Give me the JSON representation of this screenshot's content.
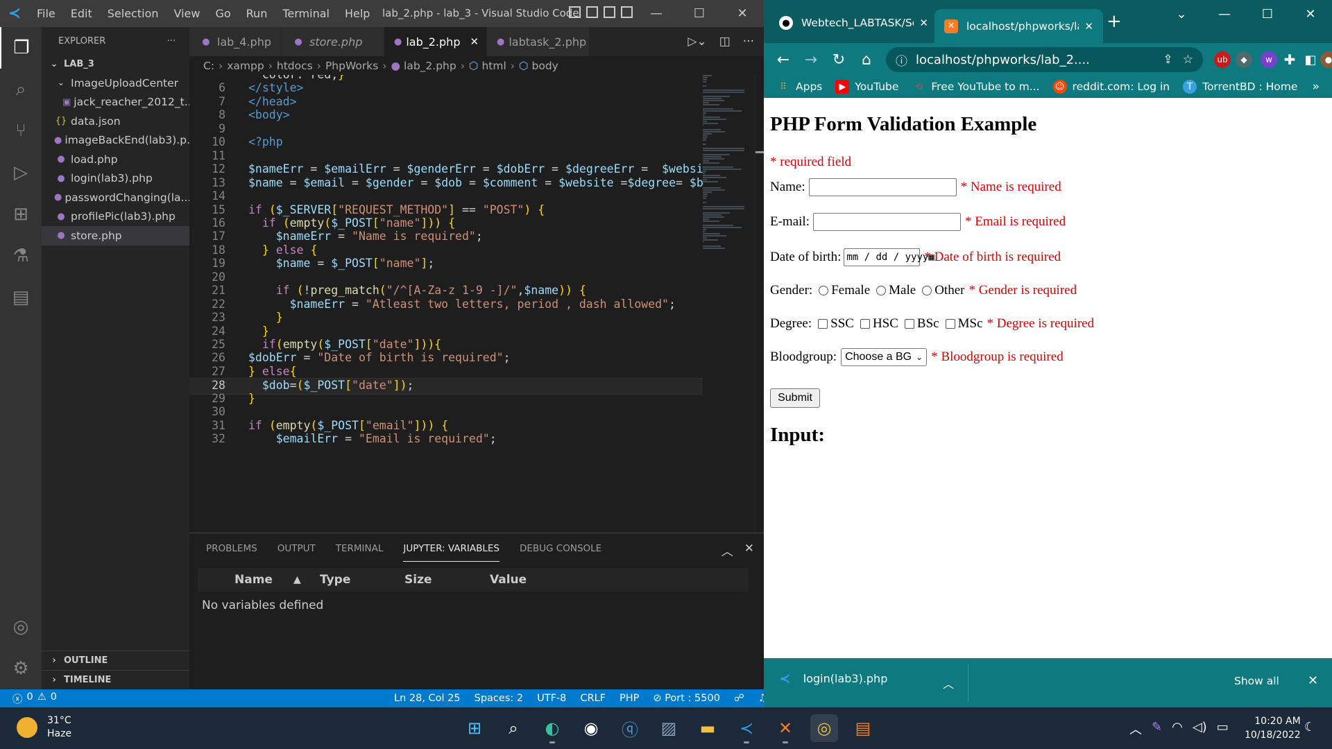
{
  "vscode": {
    "menu": [
      "File",
      "Edit",
      "Selection",
      "View",
      "Go",
      "Run",
      "Terminal",
      "Help"
    ],
    "title": "lab_2.php - lab_3 - Visual Studio Code",
    "explorer": {
      "header": "EXPLORER",
      "more": "···",
      "folder": "LAB_3",
      "items": [
        {
          "name": "ImageUploadCenter",
          "kind": "folder"
        },
        {
          "name": "jack_reacher_2012_t...",
          "kind": "image"
        },
        {
          "name": "data.json",
          "kind": "json"
        },
        {
          "name": "imageBackEnd(lab3).p...",
          "kind": "php"
        },
        {
          "name": "load.php",
          "kind": "php"
        },
        {
          "name": "login(lab3).php",
          "kind": "php"
        },
        {
          "name": "passwordChanging(la...",
          "kind": "php"
        },
        {
          "name": "profilePic(lab3).php",
          "kind": "php"
        },
        {
          "name": "store.php",
          "kind": "php"
        }
      ],
      "outline": "OUTLINE",
      "timeline": "TIMELINE"
    },
    "tabs": [
      "lab_4.php",
      "store.php",
      "lab_2.php",
      "labtask_2.php"
    ],
    "active_tab_index": 2,
    "breadcrumb": [
      "C:",
      "xampp",
      "htdocs",
      "PhpWorks",
      "lab_2.php",
      "html",
      "body"
    ],
    "code_lines": [
      {
        "n": "",
        "text": "  color: red;}"
      },
      {
        "n": "6",
        "text": "</style>"
      },
      {
        "n": "7",
        "text": "</head>"
      },
      {
        "n": "8",
        "text": "<body>"
      },
      {
        "n": "9",
        "text": ""
      },
      {
        "n": "10",
        "text": "<?php"
      },
      {
        "n": "11",
        "text": ""
      },
      {
        "n": "12",
        "text": "$nameErr = $emailErr = $genderErr = $dobErr = $degreeErr =  $websit"
      },
      {
        "n": "13",
        "text": "$name = $email = $gender = $dob = $comment = $website =$degree= $bl"
      },
      {
        "n": "14",
        "text": ""
      },
      {
        "n": "15",
        "text": "if ($_SERVER[\"REQUEST_METHOD\"] == \"POST\") {"
      },
      {
        "n": "16",
        "text": "  if (empty($_POST[\"name\"])) {"
      },
      {
        "n": "17",
        "text": "    $nameErr = \"Name is required\";"
      },
      {
        "n": "18",
        "text": "  } else {"
      },
      {
        "n": "19",
        "text": "    $name = $_POST[\"name\"];"
      },
      {
        "n": "20",
        "text": ""
      },
      {
        "n": "21",
        "text": "    if (!preg_match(\"/^[A-Za-z 1-9 -]/\",$name)) {"
      },
      {
        "n": "22",
        "text": "      $nameErr = \"Atleast two letters, period , dash allowed\";"
      },
      {
        "n": "23",
        "text": "    }"
      },
      {
        "n": "24",
        "text": "  }"
      },
      {
        "n": "25",
        "text": "  if(empty($_POST[\"date\"])){"
      },
      {
        "n": "26",
        "text": "$dobErr = \"Date of birth is required\";"
      },
      {
        "n": "27",
        "text": "} else{"
      },
      {
        "n": "28",
        "text": "  $dob=($_POST[\"date\"]);"
      },
      {
        "n": "29",
        "text": "}"
      },
      {
        "n": "30",
        "text": ""
      },
      {
        "n": "31",
        "text": "if (empty($_POST[\"email\"])) {"
      },
      {
        "n": "32",
        "text": "    $emailErr = \"Email is required\";"
      }
    ],
    "current_line": "28",
    "panel": {
      "tabs": [
        "PROBLEMS",
        "OUTPUT",
        "TERMINAL",
        "JUPYTER: VARIABLES",
        "DEBUG CONSOLE"
      ],
      "active_tab_index": 3,
      "columns": [
        "Name",
        "Type",
        "Size",
        "Value"
      ],
      "empty_message": "No variables defined"
    },
    "status": {
      "errors": "0",
      "warnings": "0",
      "position": "Ln 28, Col 25",
      "spaces": "Spaces: 2",
      "encoding": "UTF-8",
      "eol": "CRLF",
      "language": "PHP",
      "port": "Port : 5500"
    }
  },
  "chrome": {
    "tabs": [
      {
        "title": "Webtech_LABTASK/Sec",
        "favicon": "github-icon"
      },
      {
        "title": "localhost/phpworks/lab",
        "favicon": "xampp-icon"
      }
    ],
    "active_tab_index": 1,
    "url": "localhost/phpworks/lab_2....",
    "bookmarks": [
      "Apps",
      "YouTube",
      "Free YouTube to m...",
      "reddit.com: Log in",
      "TorrentBD : Home"
    ],
    "page": {
      "heading": "PHP Form Validation Example",
      "required_note": "* required field",
      "name_label": "Name:",
      "name_error": "* Name is required",
      "email_label": "E-mail:",
      "email_error": "* Email is required",
      "dob_label": "Date of birth:",
      "dob_placeholder": "mm / dd / yyyy",
      "dob_error": "* Date of birth is required",
      "gender_label": "Gender:",
      "gender_options": [
        "Female",
        "Male",
        "Other"
      ],
      "gender_error": "* Gender is required",
      "degree_label": "Degree:",
      "degree_options": [
        "SSC",
        "HSC",
        "BSc",
        "MSc"
      ],
      "degree_error": "* Degree is required",
      "bloodgroup_label": "Bloodgroup:",
      "bloodgroup_selected": "Choose a BG",
      "bloodgroup_error": "* Bloodgroup is required",
      "submit_label": "Submit",
      "input_heading": "Input:"
    },
    "download": {
      "file": "login(lab3).php",
      "show_all": "Show all"
    }
  },
  "taskbar": {
    "weather_temp": "31°C",
    "weather_desc": "Haze",
    "time": "10:20 AM",
    "date": "10/18/2022"
  },
  "colors": {
    "vs_bg": "#1e1e1e",
    "status_blue": "#007acc",
    "chrome_teal": "#0e7a80",
    "error_red": "#e00000"
  }
}
